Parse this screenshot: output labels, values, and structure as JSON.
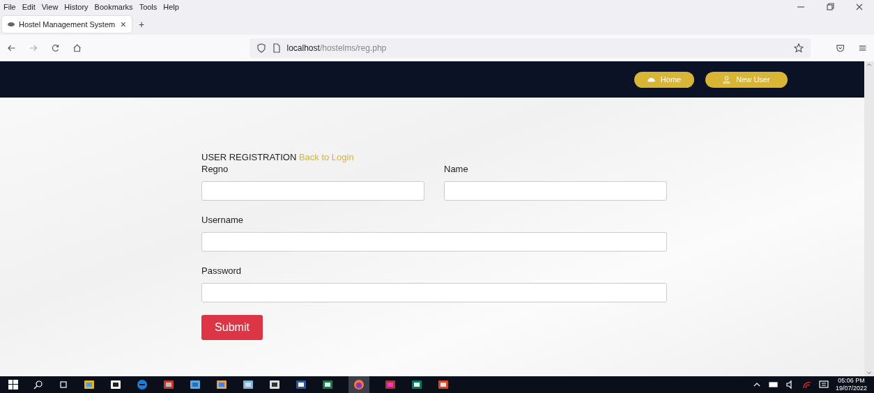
{
  "menu_bar": [
    "File",
    "Edit",
    "View",
    "History",
    "Bookmarks",
    "Tools",
    "Help"
  ],
  "tab": {
    "title": "Hostel Management System",
    "close": "×",
    "new_tab": "+"
  },
  "address_bar": {
    "host": "localhost",
    "path": "/hostelms/reg.php"
  },
  "navbar": [
    {
      "label": "Home",
      "kind": "home"
    },
    {
      "label": "New User",
      "kind": "user"
    }
  ],
  "form": {
    "heading": "USER REGISTRATION",
    "link": "Back to Login",
    "fields": [
      {
        "label": "Regno",
        "kind": "half"
      },
      {
        "label": "Name",
        "kind": "half"
      },
      {
        "label": "Username",
        "kind": "full"
      },
      {
        "label": "Password",
        "kind": "full"
      }
    ],
    "submit": "Submit"
  },
  "clock": {
    "time": "05:06 PM",
    "date": "19/07/2022"
  }
}
